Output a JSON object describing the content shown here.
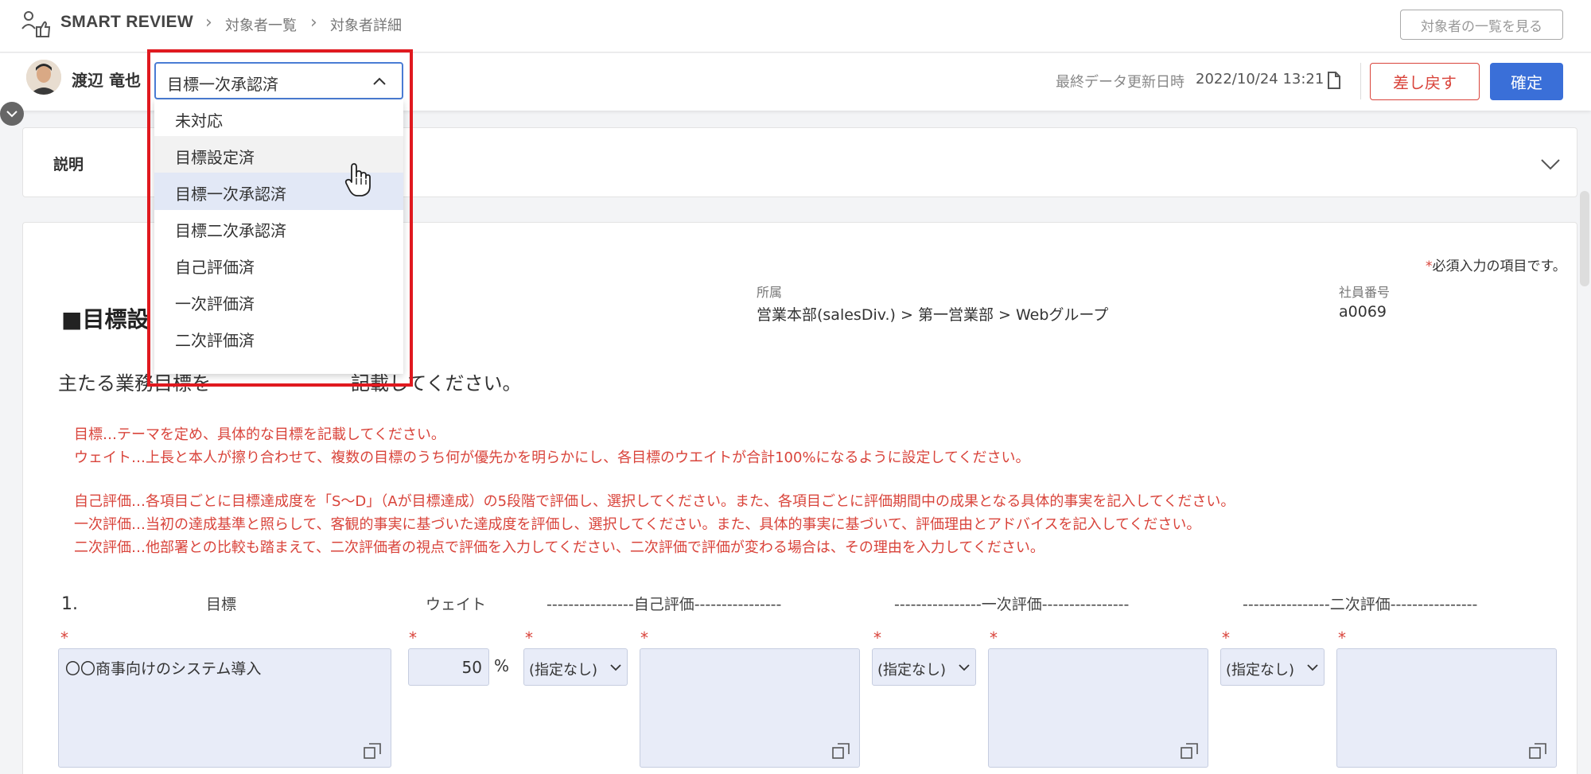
{
  "header": {
    "brand": "SMART REVIEW",
    "breadcrumbs": [
      "対象者一覧",
      "対象者詳細"
    ],
    "list_button": "対象者の一覧を見る"
  },
  "subheader": {
    "user_name": "渡辺 竜也",
    "status_selected": "目標一次承認済",
    "last_update_label": "最終データ更新日時",
    "last_update_value": "2022/10/24 13:21",
    "reject_button": "差し戻す",
    "confirm_button": "確定"
  },
  "explanation": {
    "title": "説明"
  },
  "dropdown": {
    "options": [
      "未対応",
      "目標設定済",
      "目標一次承認済",
      "目標二次承認済",
      "自己評価済",
      "一次評価済",
      "二次評価済"
    ],
    "hovered": "目標設定済"
  },
  "main": {
    "required_note_star": "*",
    "required_note": "必須入力の項目です。",
    "department_label": "所属",
    "department_value": "営業本部(salesDiv.) > 第一営業部 > Webグループ",
    "employee_id_label": "社員番号",
    "employee_id_value": "a0069",
    "section_title": "■目標設",
    "section_lead": "主たる業務目標を",
    "section_lead_tail": "記載してください。",
    "instructions": [
      "目標…テーマを定め、具体的な目標を記載してください。",
      "ウェイト…上長と本人が擦り合わせて、複数の目標のうち何が優先かを明らかにし、各目標のウエイトが合計100%になるように設定してください。",
      "自己評価…各項目ごとに目標達成度を「S～D」（Aが目標達成）の5段階で評価し、選択してください。また、各項目ごとに評価期間中の成果となる具体的事実を記入してください。",
      "一次評価…当初の達成基準と照らして、客観的事実に基づいた達成度を評価し、選択してください。また、具体的事実に基づいて、評価理由とアドバイスを記入してください。",
      "二次評価…他部署との比較も踏まえて、二次評価者の視点で評価を入力してください、二次評価で評価が変わる場合は、その理由を入力してください。"
    ],
    "row_number": "1.",
    "columns": {
      "goal": "目標",
      "weight": "ウェイト",
      "self_eval": "----------------自己評価----------------",
      "first_eval": "----------------一次評価----------------",
      "second_eval": "----------------二次評価----------------"
    },
    "required_star": "*",
    "goal_value": "〇〇商事向けのシステム導入",
    "weight_value": "50",
    "weight_unit": "%",
    "grade_placeholder": "(指定なし)"
  },
  "colors": {
    "accent": "#3a6fd8",
    "danger": "#d9443b",
    "highlight": "#e0191f",
    "field_bg": "#e8ecf8"
  }
}
